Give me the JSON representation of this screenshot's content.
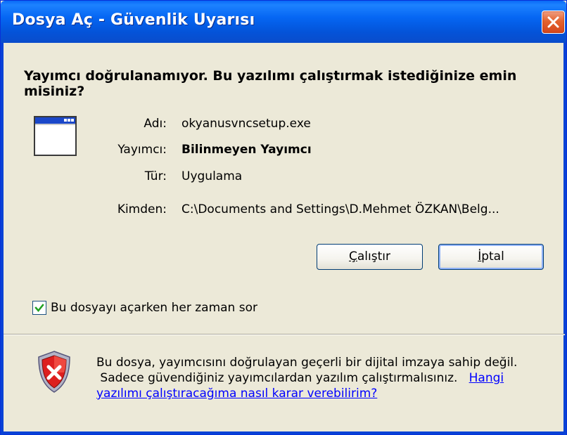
{
  "window": {
    "title": "Dosya Aç - Güvenlik Uyarısı",
    "close_icon": "close-icon"
  },
  "heading": "Yayımcı doğrulanamıyor. Bu yazılımı çalıştırmak istediğinize emin misiniz?",
  "file_icon": "application-window-icon",
  "fields": [
    {
      "label": "Adı:",
      "value": "okyanusvncsetup.exe"
    },
    {
      "label": "Yayımcı:",
      "value": "Bilinmeyen Yayımcı"
    },
    {
      "label": "Tür:",
      "value": "Uygulama"
    },
    {
      "label": "Kimden:",
      "value": "C:\\Documents and Settings\\D.Mehmet ÖZKAN\\Belg..."
    }
  ],
  "buttons": {
    "run": {
      "mnemonic": "Ç",
      "rest": "alıştır"
    },
    "cancel": {
      "mnemonic": "İ",
      "rest": "ptal"
    }
  },
  "checkbox": {
    "label": "Bu dosyayı açarken her zaman sor",
    "checked": true
  },
  "info": {
    "icon": "security-shield-icon",
    "line1": "Bu dosya, yayımcısını doğrulayan geçerli bir dijital imzaya sahip değil.",
    "line2": "Sadece güvendiğiniz yayımcılardan yazılım çalıştırmalısınız.",
    "link_part1": "Hangi",
    "link_part2": "yazılımı çalıştıracağıma nasıl karar verebilirim?"
  },
  "colors": {
    "titlebar": "#0453d8",
    "dialog_bg": "#ece9d8",
    "link": "#0000ff",
    "close_button": "#e4632f",
    "shield_red": "#cc1111"
  }
}
